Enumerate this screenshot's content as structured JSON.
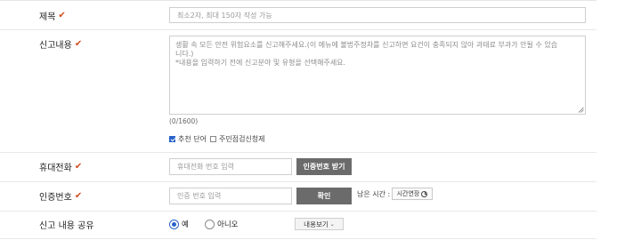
{
  "title_row": {
    "label": "제목",
    "placeholder": "최소2자, 최대 150자 작성 가능"
  },
  "content_row": {
    "label": "신고내용",
    "placeholder_line1": "생활 속 모든 안전 위험요소를 신고해주세요.(이 메뉴에 불법주정차를 신고하면 요건이 충족되지 않아 과태료 부과가 안될 수 있습",
    "placeholder_line2": "니다.)",
    "placeholder_line3": "*내용을 입력하기 전에 신고분야 및 유형을 선택해주세요.",
    "counter": "(0/1600)",
    "options": [
      {
        "label": "추천 단어",
        "checked": true
      },
      {
        "label": "주민점검신청제",
        "checked": false
      }
    ]
  },
  "phone_row": {
    "label": "휴대전화",
    "placeholder": "휴대전화 번호 입력",
    "button": "인증번호 받기"
  },
  "code_row": {
    "label": "인증번호",
    "placeholder": "인증 번호 입력",
    "button": "확인",
    "remaining_label": "남은 시간 :",
    "extend_button": "시간연장"
  },
  "share_row": {
    "label": "신고 내용 공유",
    "options": [
      {
        "label": "예",
        "selected": true
      },
      {
        "label": "아니오",
        "selected": false
      }
    ],
    "view_button": "내용보기"
  },
  "colors": {
    "required_mark": "#d24b1f",
    "dark_button": "#6b6b6b",
    "checked_blue": "#2a62c8"
  }
}
